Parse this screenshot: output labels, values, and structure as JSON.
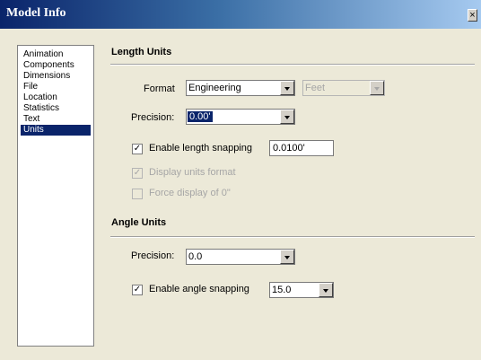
{
  "window": {
    "title": "Model Info",
    "close_icon": "close-icon"
  },
  "sidebar": {
    "items": [
      {
        "label": "Animation",
        "selected": false
      },
      {
        "label": "Components",
        "selected": false
      },
      {
        "label": "Dimensions",
        "selected": false
      },
      {
        "label": "File",
        "selected": false
      },
      {
        "label": "Location",
        "selected": false
      },
      {
        "label": "Statistics",
        "selected": false
      },
      {
        "label": "Text",
        "selected": false
      },
      {
        "label": "Units",
        "selected": true
      }
    ]
  },
  "length_units": {
    "title": "Length Units",
    "format_label": "Format",
    "format_value": "Engineering",
    "format_unit_value": "Feet",
    "precision_label": "Precision:",
    "precision_value": "0.00'",
    "enable_snapping_label": "Enable length snapping",
    "enable_snapping_checked": true,
    "snapping_value": "0.0100'",
    "display_units_label": "Display units format",
    "display_units_checked": true,
    "force_display_label": "Force display of 0\"",
    "force_display_checked": false
  },
  "angle_units": {
    "title": "Angle Units",
    "precision_label": "Precision:",
    "precision_value": "0.0",
    "enable_snapping_label": "Enable angle snapping",
    "enable_snapping_checked": true,
    "snapping_value": "15.0"
  },
  "colors": {
    "title_bar_start": "#0a246a",
    "selection": "#0a246a",
    "dialog_bg": "#ece9d8"
  }
}
